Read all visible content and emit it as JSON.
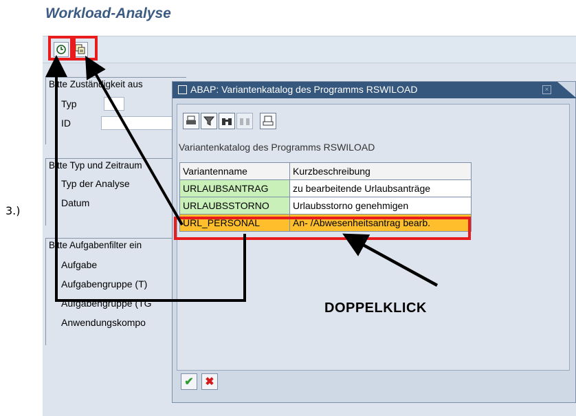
{
  "screen": {
    "title": "Workload-Analyse"
  },
  "toolbar": {
    "icons": [
      "execute-clock-icon",
      "variant-catalog-icon"
    ]
  },
  "groups": [
    {
      "header": "Bitte Zuständigkeit auswählen:",
      "header_visible": "Bitte Zuständigkeit aus",
      "fields": [
        "Typ",
        "ID"
      ]
    },
    {
      "header": "Bitte Typ und Zeitraum",
      "header_visible": "Bitte Typ und Zeitraum",
      "fields": [
        "Typ der Analyse",
        "Datum"
      ]
    },
    {
      "header": "Bitte Aufgabenfilter ein",
      "header_visible": "Bitte Aufgabenfilter ein",
      "fields": [
        "Aufgabe",
        "Aufgabengruppe (T)",
        "Aufgabengruppe (TG",
        "Anwendungskompo"
      ]
    }
  ],
  "dialog": {
    "title": "ABAP: Variantenkatalog des Programms RSWILOAD",
    "catalog_label": "Variantenkatalog des Programms RSWILOAD",
    "columns": [
      "Variantenname",
      "Kurzbeschreibung"
    ],
    "rows": [
      {
        "name": "URLAUBSANTRAG",
        "description": "zu bearbeitende Urlaubsanträge"
      },
      {
        "name": "URLAUBSSTORNO",
        "description": "Urlaubsstorno genehmigen"
      },
      {
        "name": "URL_PERSONAL",
        "description": "An- /Abwesenheitsantrag bearb."
      }
    ],
    "selected_row": 2,
    "confirm_icon": "green-checkmark-icon",
    "cancel_icon": "red-x-icon"
  },
  "annotations": {
    "step": "3.)",
    "instruction": "DOPPELKLICK",
    "highlight_color": "#e81c1c"
  }
}
